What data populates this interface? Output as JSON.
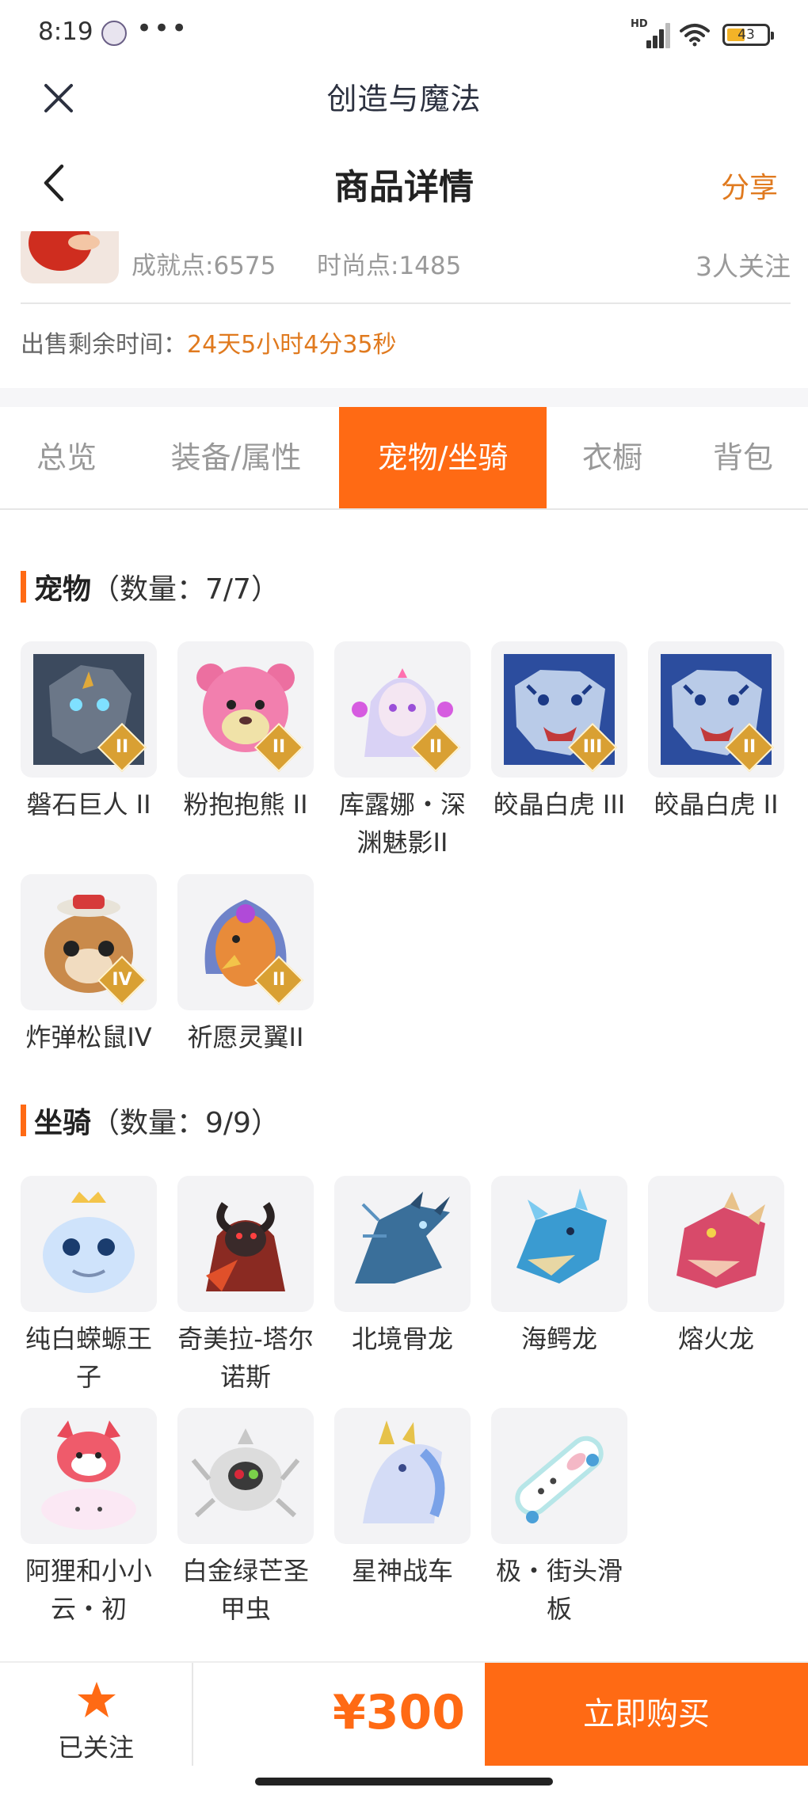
{
  "status_bar": {
    "time": "8:19",
    "dots": "•••",
    "battery": "43"
  },
  "web_title": "创造与魔法",
  "header": {
    "title": "商品详情",
    "share": "分享"
  },
  "info": {
    "achievement": "成就点:6575",
    "fashion": "时尚点:1485",
    "followers": "3人关注"
  },
  "sale": {
    "label": "出售剩余时间：",
    "countdown": "24天5小时4分35秒"
  },
  "tabs": [
    {
      "label": "总览",
      "active": false
    },
    {
      "label": "装备/属性",
      "active": false
    },
    {
      "label": "宠物/坐骑",
      "active": true
    },
    {
      "label": "衣橱",
      "active": false
    },
    {
      "label": "背包",
      "active": false
    }
  ],
  "pets": {
    "title": "宠物",
    "count": "（数量：7/7）",
    "items": [
      {
        "name": "磐石巨人 II",
        "badge": "II",
        "icon": "stone-giant-icon"
      },
      {
        "name": "粉抱抱熊 II",
        "badge": "II",
        "icon": "pink-bear-icon"
      },
      {
        "name": "库露娜・深渊魅影II",
        "badge": "II",
        "icon": "kuluna-icon"
      },
      {
        "name": "皎晶白虎 III",
        "badge": "III",
        "icon": "white-tiger-icon"
      },
      {
        "name": "皎晶白虎 II",
        "badge": "II",
        "icon": "white-tiger-icon"
      },
      {
        "name": "炸弹松鼠IV",
        "badge": "IV",
        "icon": "bomb-squirrel-icon"
      },
      {
        "name": "祈愿灵翼II",
        "badge": "II",
        "icon": "wish-wing-icon"
      }
    ]
  },
  "mounts": {
    "title": "坐骑",
    "count": "（数量：9/9）",
    "items": [
      {
        "name": "纯白蝾螈王子",
        "icon": "white-salamander-icon"
      },
      {
        "name": "奇美拉-塔尔诺斯",
        "icon": "chimera-icon"
      },
      {
        "name": "北境骨龙",
        "icon": "bone-dragon-icon"
      },
      {
        "name": "海鳄龙",
        "icon": "sea-croc-dragon-icon"
      },
      {
        "name": "熔火龙",
        "icon": "lava-dragon-icon"
      },
      {
        "name": "阿狸和小小云・初",
        "icon": "ali-cloud-icon"
      },
      {
        "name": "白金绿芒圣甲虫",
        "icon": "scarab-icon"
      },
      {
        "name": "星神战车",
        "icon": "star-chariot-icon"
      },
      {
        "name": "极・街头滑板",
        "icon": "skateboard-icon"
      }
    ]
  },
  "bottom": {
    "follow_label": "已关注",
    "price": "¥300",
    "buy_label": "立即购买"
  },
  "colors": {
    "accent": "#ff6a14",
    "highlight": "#e07a1f"
  }
}
